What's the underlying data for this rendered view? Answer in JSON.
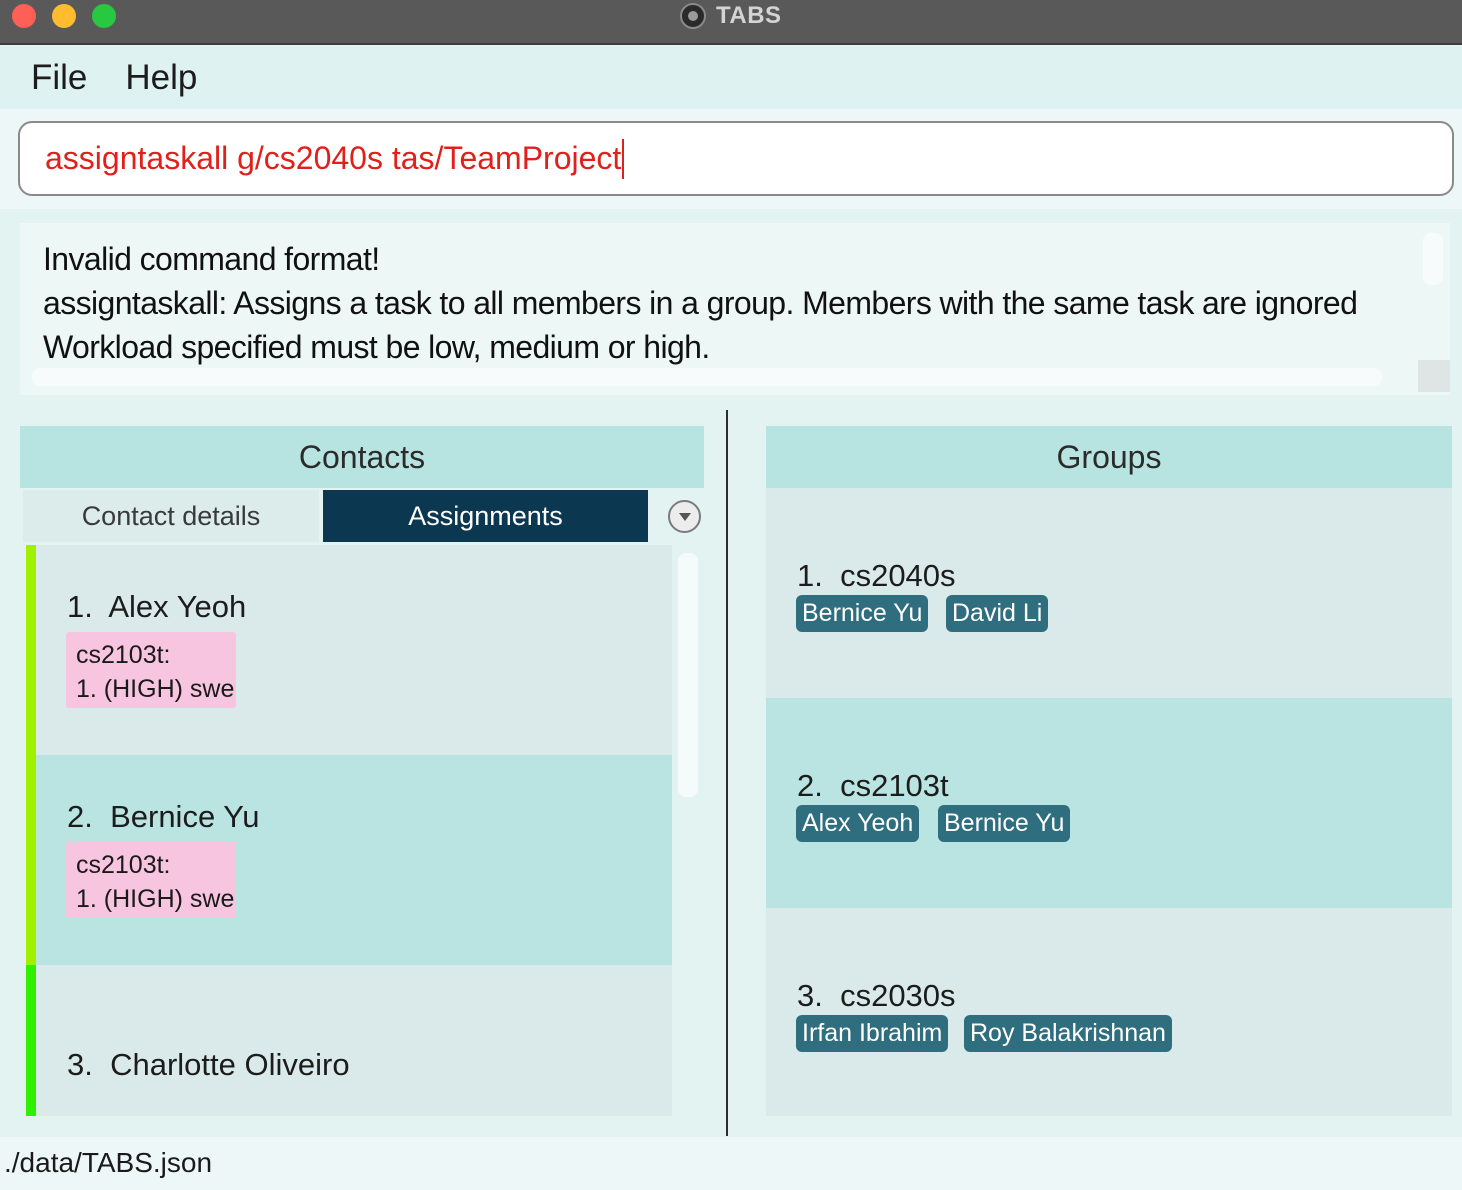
{
  "window": {
    "title": "TABS"
  },
  "menu": {
    "file": "File",
    "help": "Help"
  },
  "command": {
    "value": "assigntaskall g/cs2040s tas/TeamProject"
  },
  "result": {
    "line1": "Invalid command format!",
    "line2": "assigntaskall: Assigns a task to all members in a group. Members with the same task are ignored",
    "line3": "Workload specified must be low, medium or high."
  },
  "contacts": {
    "header": "Contacts",
    "tabs": {
      "details": "Contact details",
      "assignments": "Assignments"
    },
    "items": [
      {
        "index_name": "1.  Alex Yeoh",
        "assignment": "cs2103t:\n1. (HIGH) swe",
        "stripe_color": "#a0f000"
      },
      {
        "index_name": "2.  Bernice Yu",
        "assignment": "cs2103t:\n1. (HIGH) swe",
        "stripe_color": "#a0f000"
      },
      {
        "index_name": "3.  Charlotte Oliveiro",
        "assignment": null,
        "stripe_color": "#2ef000"
      }
    ]
  },
  "groups": {
    "header": "Groups",
    "items": [
      {
        "index_name": "1.  cs2040s",
        "members": [
          "Bernice Yu",
          "David Li"
        ]
      },
      {
        "index_name": "2.  cs2103t",
        "members": [
          "Alex Yeoh",
          "Bernice Yu"
        ]
      },
      {
        "index_name": "3.  cs2030s",
        "members": [
          "Irfan Ibrahim",
          "Roy Balakrishnan"
        ]
      }
    ]
  },
  "status": {
    "path": "./data/TABS.json"
  },
  "colors": {
    "command_text": "#e0201a",
    "active_tab": "#0b3850",
    "member_chip": "#2e6e7e",
    "assignment_tag": "#f8c5e1",
    "row_light": "#daeaea",
    "row_dark": "#b9e4e2"
  }
}
